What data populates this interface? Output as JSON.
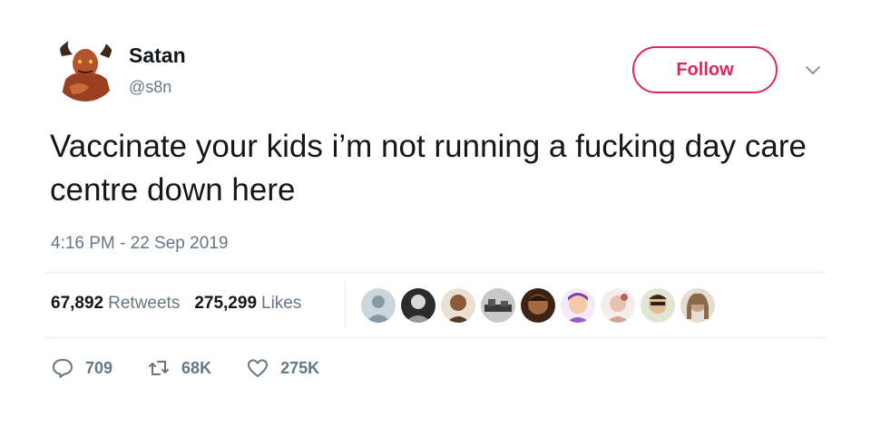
{
  "author": {
    "name": "Satan",
    "handle": "@s8n",
    "avatar_icon": "demon-avatar-icon"
  },
  "follow_button": {
    "label": "Follow",
    "color": "#e0245e"
  },
  "menu": {
    "icon": "chevron-down-icon"
  },
  "tweet": {
    "text": "Vaccinate your kids i’m not running a fucking day care centre down here",
    "timestamp": "4:16 PM - 22 Sep 2019"
  },
  "stats": {
    "retweets_count": "67,892",
    "retweets_label": "Retweets",
    "likes_count": "275,299",
    "likes_label": "Likes"
  },
  "likers": [
    {
      "icon": "default-avatar-icon"
    },
    {
      "icon": "user-avatar-icon"
    },
    {
      "icon": "user-avatar-icon"
    },
    {
      "icon": "user-avatar-icon"
    },
    {
      "icon": "user-avatar-icon"
    },
    {
      "icon": "user-avatar-icon"
    },
    {
      "icon": "user-avatar-icon"
    },
    {
      "icon": "user-avatar-icon"
    },
    {
      "icon": "user-avatar-icon"
    }
  ],
  "actions": {
    "reply_count": "709",
    "retweet_count": "68K",
    "like_count": "275K"
  },
  "colors": {
    "text": "#14171a",
    "secondary": "#657786",
    "divider": "#e6ecf0",
    "accent": "#e0245e"
  }
}
